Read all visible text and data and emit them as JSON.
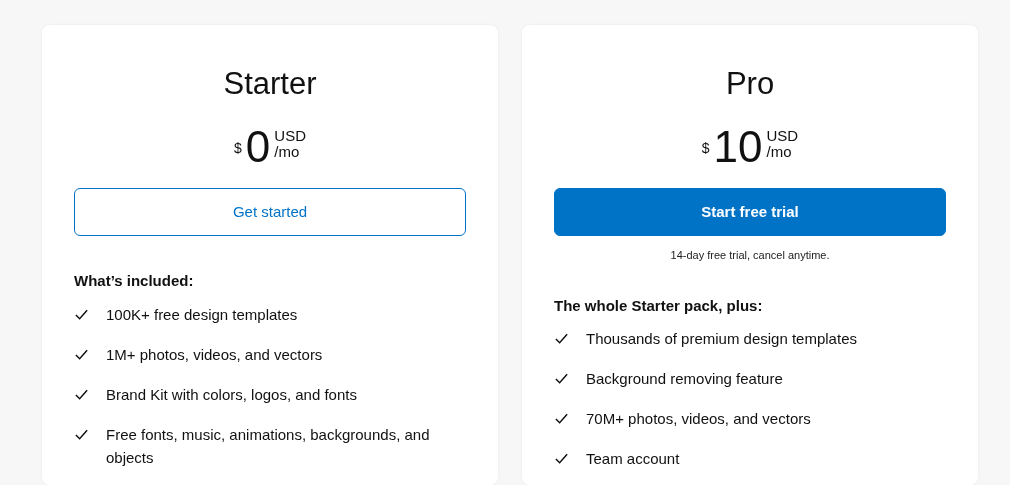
{
  "plans": [
    {
      "name": "Starter",
      "price": {
        "currency": "$",
        "amount": "0",
        "unit": "USD",
        "period": "/mo"
      },
      "button": {
        "label": "Get started",
        "kind": "outline"
      },
      "features_heading": "What’s included:",
      "features": [
        "100K+ free design templates",
        "1M+ photos, videos, and vectors",
        "Brand Kit with colors, logos, and fonts",
        "Free fonts, music, animations, backgrounds, and objects"
      ]
    },
    {
      "name": "Pro",
      "price": {
        "currency": "$",
        "amount": "10",
        "unit": "USD",
        "period": "/mo"
      },
      "button": {
        "label": "Start free trial",
        "kind": "primary"
      },
      "note": "14-day free trial, cancel anytime.",
      "features_heading": "The whole Starter pack, plus:",
      "features": [
        "Thousands of premium design templates",
        "Background removing feature",
        "70M+ photos, videos, and vectors",
        "Team account"
      ]
    }
  ]
}
